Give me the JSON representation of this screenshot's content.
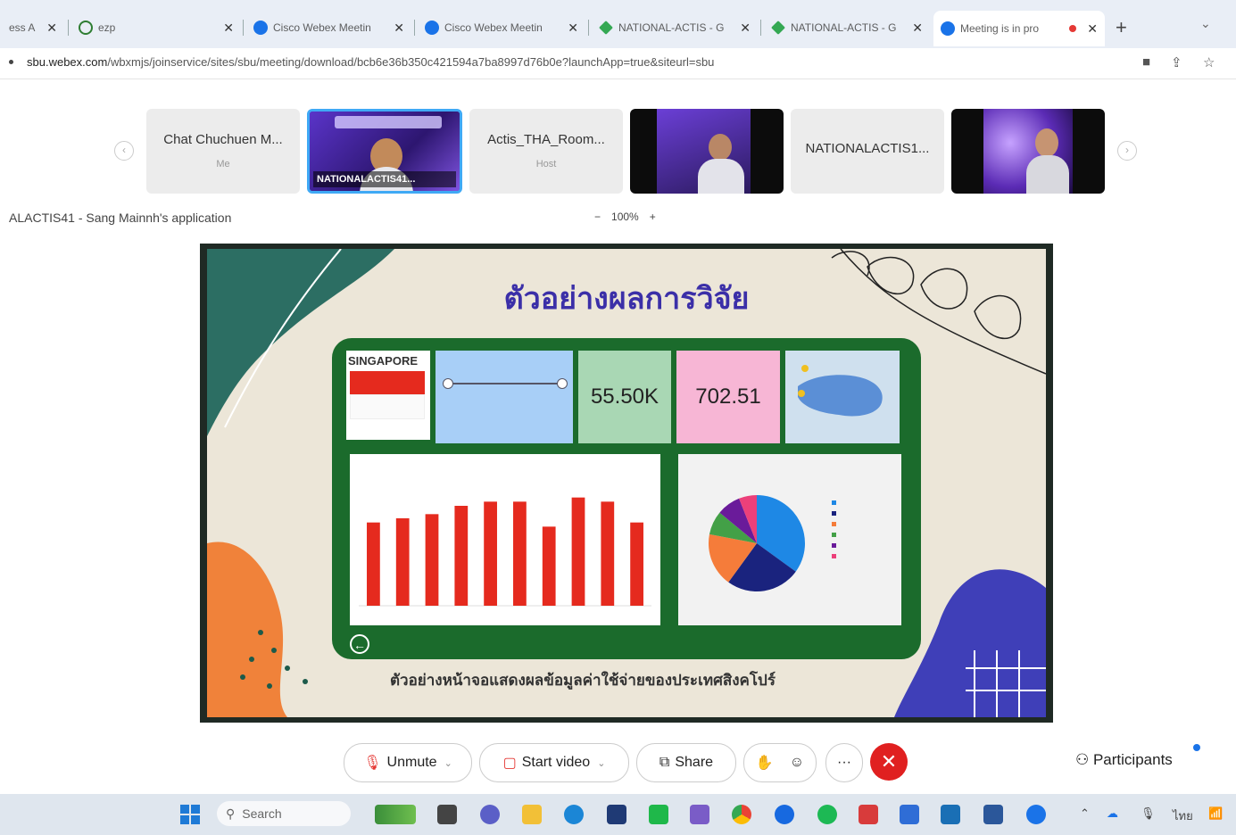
{
  "browser": {
    "tabs": [
      {
        "label": "ess A",
        "color": "#bbbbbb"
      },
      {
        "label": "ezp",
        "color": "#2e7d32"
      },
      {
        "label": "Cisco Webex Meetin",
        "color": "#1a73e8"
      },
      {
        "label": "Cisco Webex Meetin",
        "color": "#1a73e8"
      },
      {
        "label": "NATIONAL-ACTIS - G",
        "color": "#34a853"
      },
      {
        "label": "NATIONAL-ACTIS - G",
        "color": "#34a853"
      },
      {
        "label": "Meeting is in pro",
        "color": "#1a73e8"
      }
    ],
    "new_tab": "+",
    "url_host": "sbu.webex.com",
    "url_path": "/wbxmjs/joinservice/sites/sbu/meeting/download/bcb6e36b350c421594a7ba8997d76b0e?launchApp=true&siteurl=sbu"
  },
  "participants": [
    {
      "name": "Chat Chuchuen M...",
      "role": "Me",
      "type": "text"
    },
    {
      "name": "NATIONALACTIS41...",
      "role": "",
      "type": "video-presenter"
    },
    {
      "name": "Actis_THA_Room...",
      "role": "Host",
      "type": "text"
    },
    {
      "name": "",
      "role": "",
      "type": "video"
    },
    {
      "name": "NATIONALACTIS1...",
      "role": "",
      "type": "text"
    },
    {
      "name": "",
      "role": "",
      "type": "video"
    }
  ],
  "share_label": "ALACTIS41 - Sang Mainnh's application",
  "zoom": {
    "minus": "−",
    "value": "100%",
    "plus": "+"
  },
  "slide": {
    "title": "ตัวอย่างผลการวิจัย",
    "country": "SINGAPORE",
    "kpi1": "55.50K",
    "kpi2": "702.51",
    "caption": "ตัวอย่างหน้าจอแสดงผลข้อมูลค่าใช้จ่ายของประเทศสิงคโปร์",
    "colors": {
      "dash_green": "#1b6b2c",
      "title": "#3b2fa8",
      "kpi_green": "#a9d7b4",
      "kpi_pink": "#f7b6d5",
      "slicer_blue": "#a8cff7",
      "bar_red": "#e52a1e"
    }
  },
  "chart_data": [
    {
      "type": "bar",
      "series": [
        {
          "values": [
            20,
            21,
            22,
            24,
            25,
            25,
            19,
            26,
            25,
            20
          ]
        }
      ],
      "ylim": [
        0,
        30
      ]
    },
    {
      "type": "pie",
      "values": [
        35,
        25,
        18,
        8,
        8,
        6
      ],
      "colors": [
        "#1e88e5",
        "#1a237e",
        "#f57c3a",
        "#43a047",
        "#6a1b9a",
        "#ec407a"
      ]
    }
  ],
  "controls": {
    "unmute": "Unmute",
    "start_video": "Start video",
    "share": "Share",
    "end": "✕",
    "participants": "Participants"
  },
  "taskbar": {
    "search": "Search",
    "tray_lang": "ไทย"
  }
}
